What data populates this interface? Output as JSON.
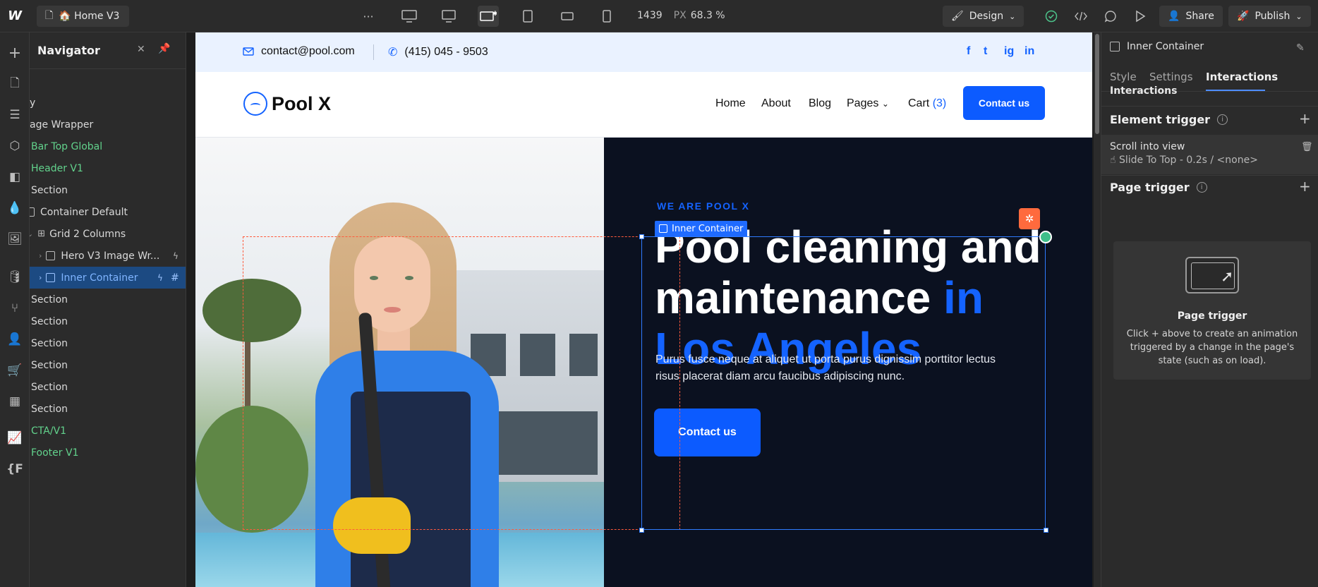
{
  "topbar": {
    "logo": "W",
    "page": "🏠 Home V3",
    "more": "···",
    "width": "1439",
    "unit": "PX",
    "zoom": "68.3 %",
    "design_label": "Design",
    "share_label": "Share",
    "publish_label": "Publish"
  },
  "navigator": {
    "title": "Navigator",
    "items": [
      {
        "label": "y"
      },
      {
        "label": "age Wrapper"
      },
      {
        "label": "Bar Top Global"
      },
      {
        "label": "Header V1"
      },
      {
        "label": "Section"
      },
      {
        "label": "Container Default"
      },
      {
        "label": "Grid 2 Columns"
      },
      {
        "label": "Hero V3 Image Wr..."
      },
      {
        "label": "Inner Container"
      },
      {
        "label": "Section"
      },
      {
        "label": "Section"
      },
      {
        "label": "Section"
      },
      {
        "label": "Section"
      },
      {
        "label": "Section"
      },
      {
        "label": "Section"
      },
      {
        "label": "CTA/V1"
      },
      {
        "label": "Footer V1"
      }
    ]
  },
  "site": {
    "email": "contact@pool.com",
    "phone": "(415) 045 - 9503",
    "social": [
      "f",
      "t",
      "ig",
      "in"
    ],
    "brand": "Pool X",
    "menu": {
      "home": "Home",
      "about": "About",
      "blog": "Blog",
      "pages": "Pages",
      "cart": "Cart",
      "cart_count": "(3)"
    },
    "contact_button": "Contact us",
    "hero": {
      "pre_title": "WE ARE POOL X",
      "title_line1": "Pool cleaning and",
      "title_line2": "maintenance ",
      "title_accent1": "in",
      "title_accent2": "Los Angeles",
      "description": "Purus fusce neque at aliquet ut porta purus dignissim porttitor lectus risus placerat diam arcu faucibus adipiscing nunc.",
      "button": "Contact us"
    }
  },
  "selection": {
    "label": "Inner Container"
  },
  "right_panel": {
    "element": "Inner Container",
    "tabs": {
      "style": "Style",
      "settings": "Settings",
      "interactions": "Interactions"
    },
    "interactions_header": "Interactions",
    "element_trigger": "Element trigger",
    "trigger_name": "Scroll into view",
    "trigger_detail": "☝ Slide To Top - 0.2s / <none>",
    "page_trigger": "Page trigger",
    "card_title": "Page trigger",
    "card_desc": "Click + above to create an animation triggered by a change in the page's state (such as on load)."
  },
  "colors": {
    "accent": "#1463ff",
    "component": "#62d28c",
    "hero_bg": "#0b1120"
  }
}
